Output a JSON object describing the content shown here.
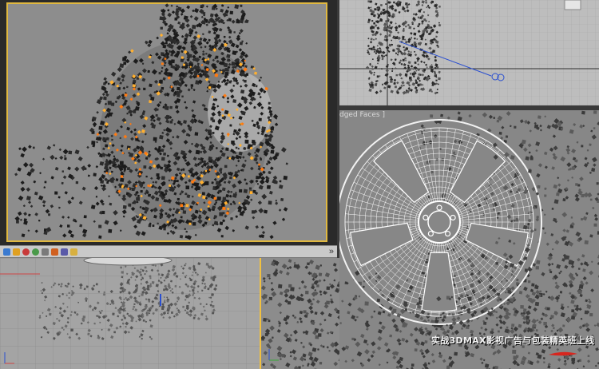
{
  "app": {
    "name": "3ds Max"
  },
  "viewports": {
    "right_top": {
      "label_fragment": ""
    },
    "right_bottom": {
      "label": "dged Faces ]"
    }
  },
  "toolbar": {
    "icons": [
      "render-setup-icon",
      "render-frame-icon",
      "material-editor-icon",
      "sphere-icon",
      "teapot-icon",
      "channel-icon",
      "gear-icon",
      "render-icon"
    ],
    "collapse_glyph": "»"
  },
  "watermark": {
    "text": "实战3DMAX影视广告与包装精英班上线"
  },
  "colors": {
    "perspective_bg": "#8f8f8f",
    "ortho_bg": "#bcbcbc",
    "grid_dark_bg": "#9a9a9a",
    "wire_bg": "#878787",
    "fire": "#ffb030",
    "selection_border": "#f0c040",
    "spline": "#2a4fd0"
  }
}
